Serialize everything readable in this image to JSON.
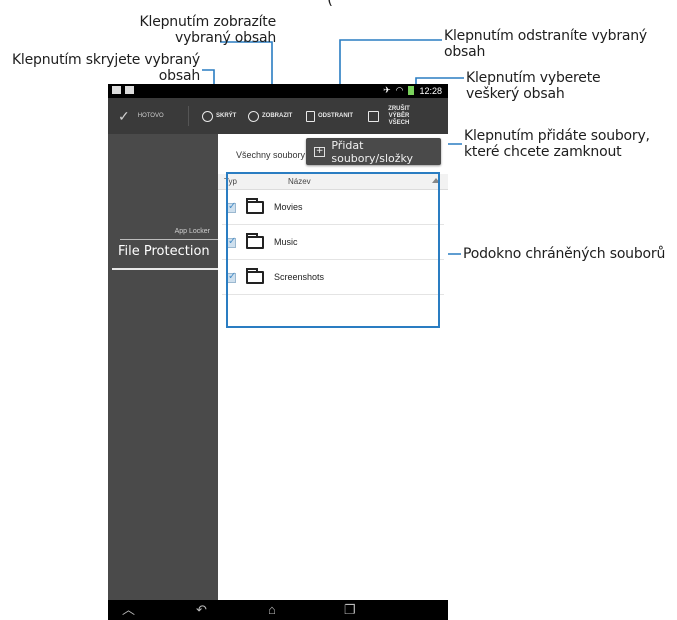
{
  "callouts": {
    "top_title": "(",
    "show": [
      "Klepnutím zobrazíte",
      "vybraný obsah"
    ],
    "hide": [
      "Klepnutím skryjete vybraný",
      "obsah"
    ],
    "delete": [
      "Klepnutím odstraníte vybraný",
      "obsah"
    ],
    "select_all": [
      "Klepnutím vyberete",
      "veškerý obsah"
    ],
    "add": [
      "Klepnutím přidáte soubory,",
      "které chcete zamknout"
    ],
    "pane": "Podokno chráněných souborů"
  },
  "statusbar": {
    "time": "12:28"
  },
  "actionbar": {
    "done": "HOTOVO",
    "hide": "SKRÝT",
    "show": "ZOBRAZIT",
    "delete": "ODSTRANIT",
    "deselect_line1": "ZRUŠIT VÝBĚR",
    "deselect_line2": "VŠECH"
  },
  "sidebar": {
    "group": "App Locker",
    "item": "File Protection"
  },
  "content": {
    "filter": "Všechny soubory",
    "add_button": "Přidat soubory/složky",
    "columns": {
      "type": "Typ",
      "name": "Název"
    },
    "rows": [
      {
        "name": "Movies",
        "checked": true
      },
      {
        "name": "Music",
        "checked": true
      },
      {
        "name": "Screenshots",
        "checked": true
      }
    ]
  },
  "colors": {
    "callout_line": "#2a7dc2",
    "actionbar": "#3a3a3a",
    "sidebar": "#4a4a4a"
  },
  "icons": [
    "check-icon",
    "eye-slash-icon",
    "eye-icon",
    "trash-icon",
    "cursor-select-icon",
    "add-file-icon",
    "folder-icon",
    "sort-asc-icon",
    "nav-down-icon",
    "nav-back-icon",
    "nav-home-icon",
    "nav-recent-icon"
  ]
}
